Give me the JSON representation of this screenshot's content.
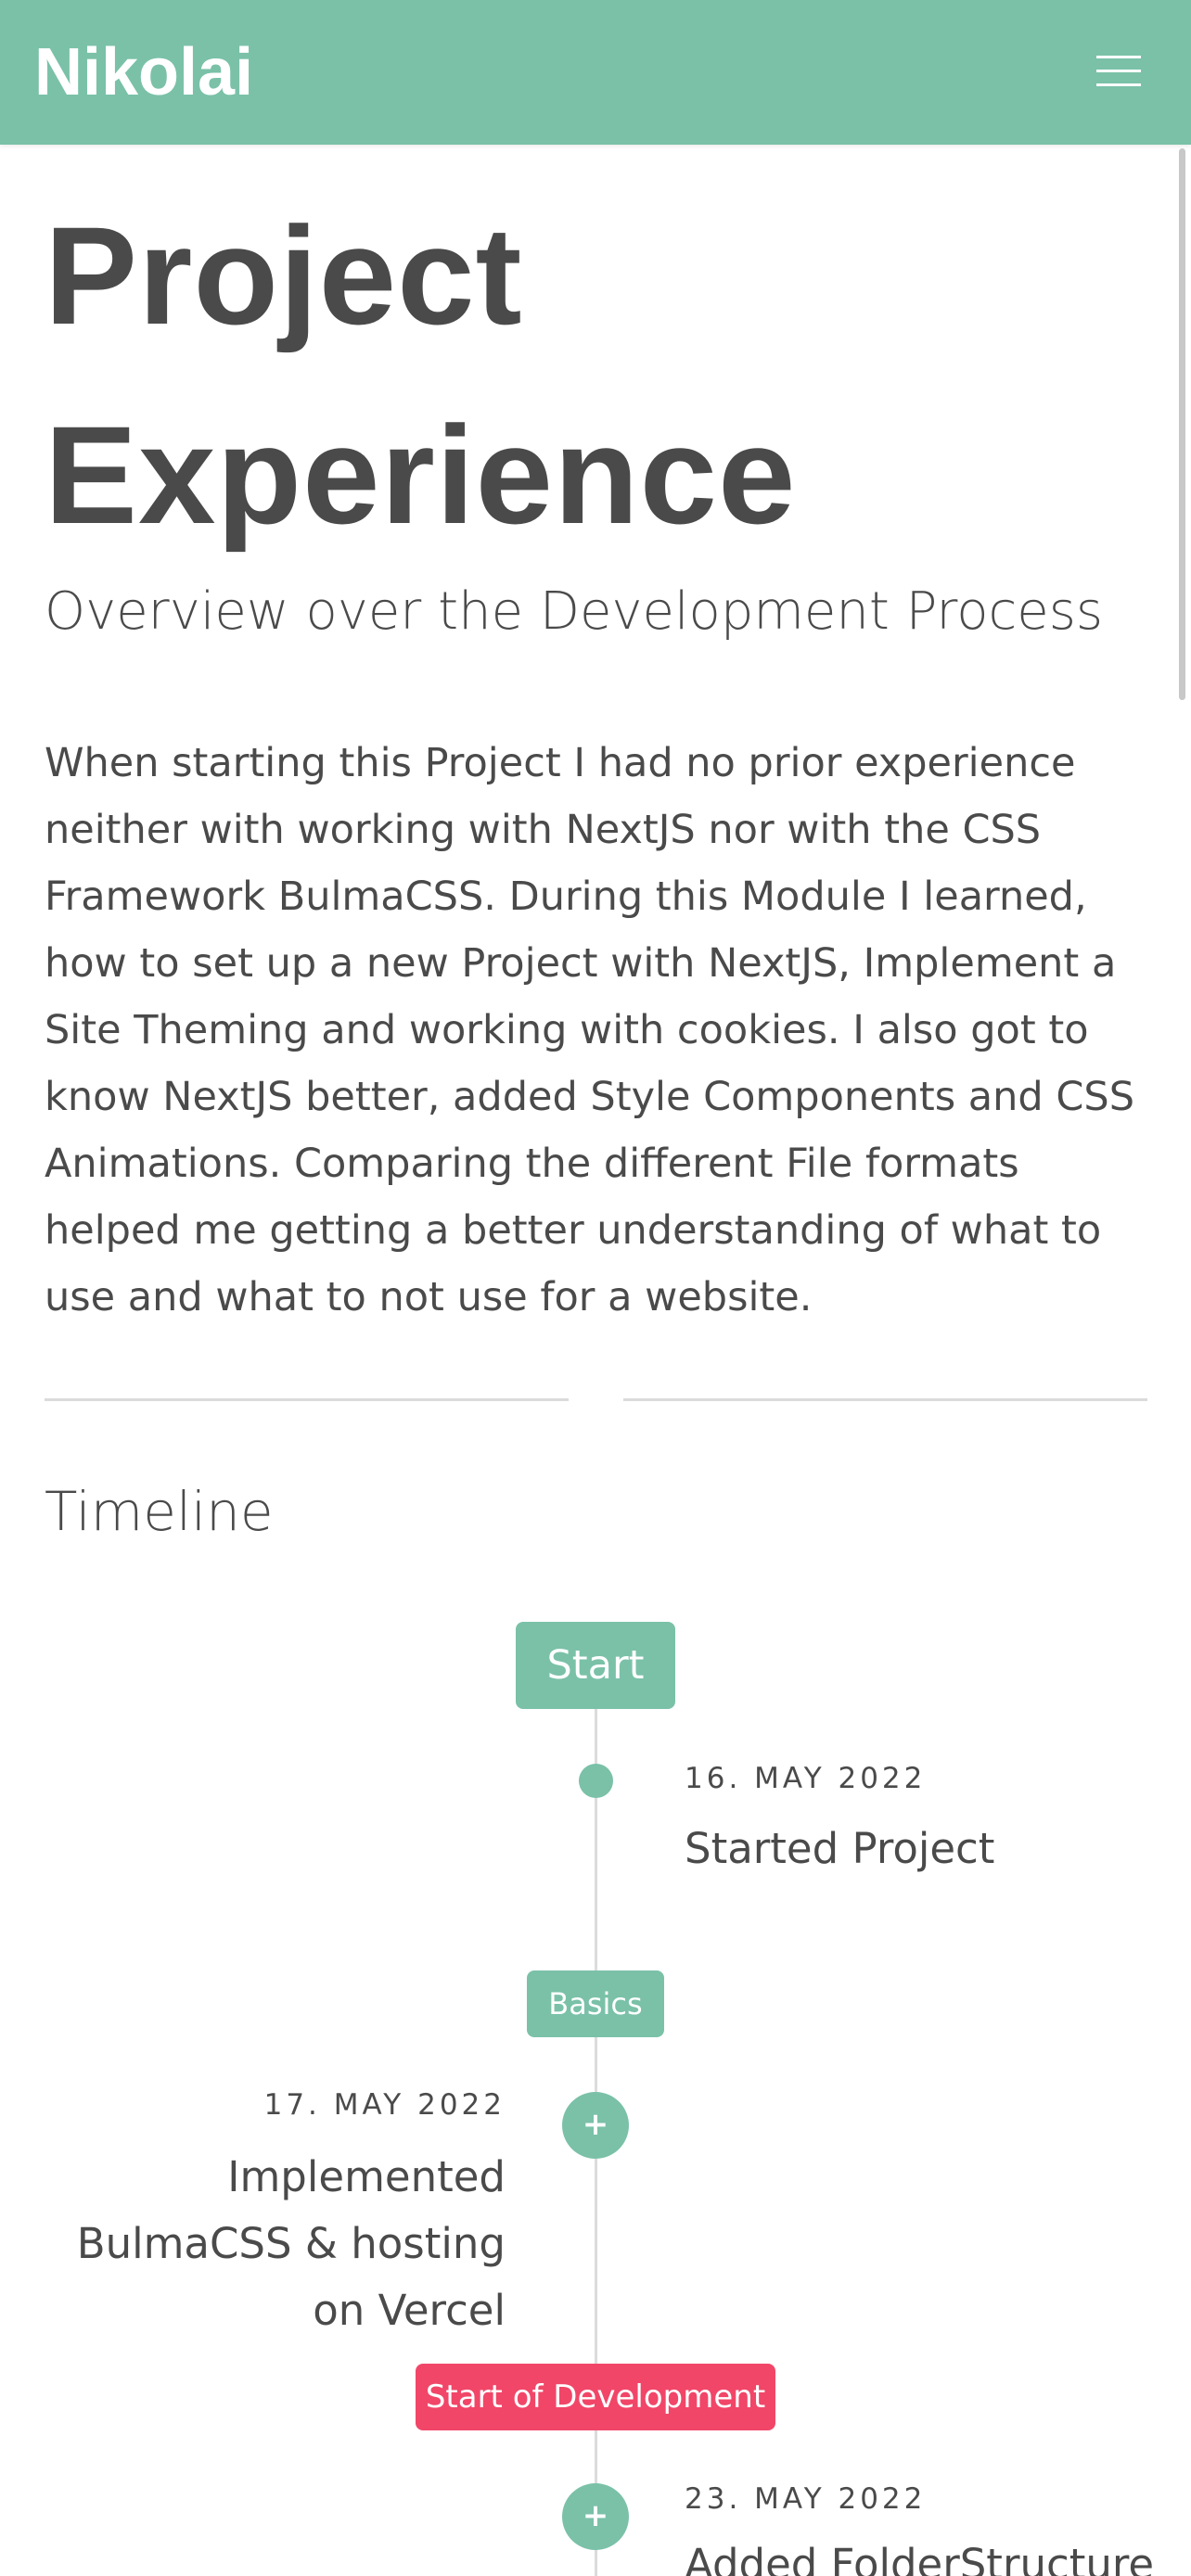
{
  "navbar": {
    "brand": "Nikolai",
    "menu_icon": "hamburger-menu-icon"
  },
  "hero": {
    "title": "Project Experience",
    "subtitle": "Overview over the Development Process",
    "intro": "When starting this Project I had no prior experience neither with working with NextJS nor with the CSS Framework BulmaCSS. During this Module I learned, how to set up a new Project with NextJS, Implement a Site Theming and working with cookies. I also got to know NextJS better, added Style Components and CSS Animations. Comparing the different File formats helped me getting a better understanding of what to use and what to not use for a website."
  },
  "timeline": {
    "heading": "Timeline",
    "tags": {
      "start": "Start",
      "basics": "Basics",
      "development": "Start of Development"
    },
    "items": [
      {
        "date": "16. MAY 2022",
        "text": "Started Project",
        "marker": "dot"
      },
      {
        "date": "17. MAY 2022",
        "text": "Implemented BulmaCSS & hosting on Vercel",
        "marker": "+"
      },
      {
        "date": "23. MAY 2022",
        "text": "Added FolderStructure",
        "marker": "+"
      }
    ]
  },
  "colors": {
    "primary": "#7ac1a8",
    "danger": "#f14668",
    "text": "#4a4a4a",
    "divider": "#dbdbdb"
  }
}
